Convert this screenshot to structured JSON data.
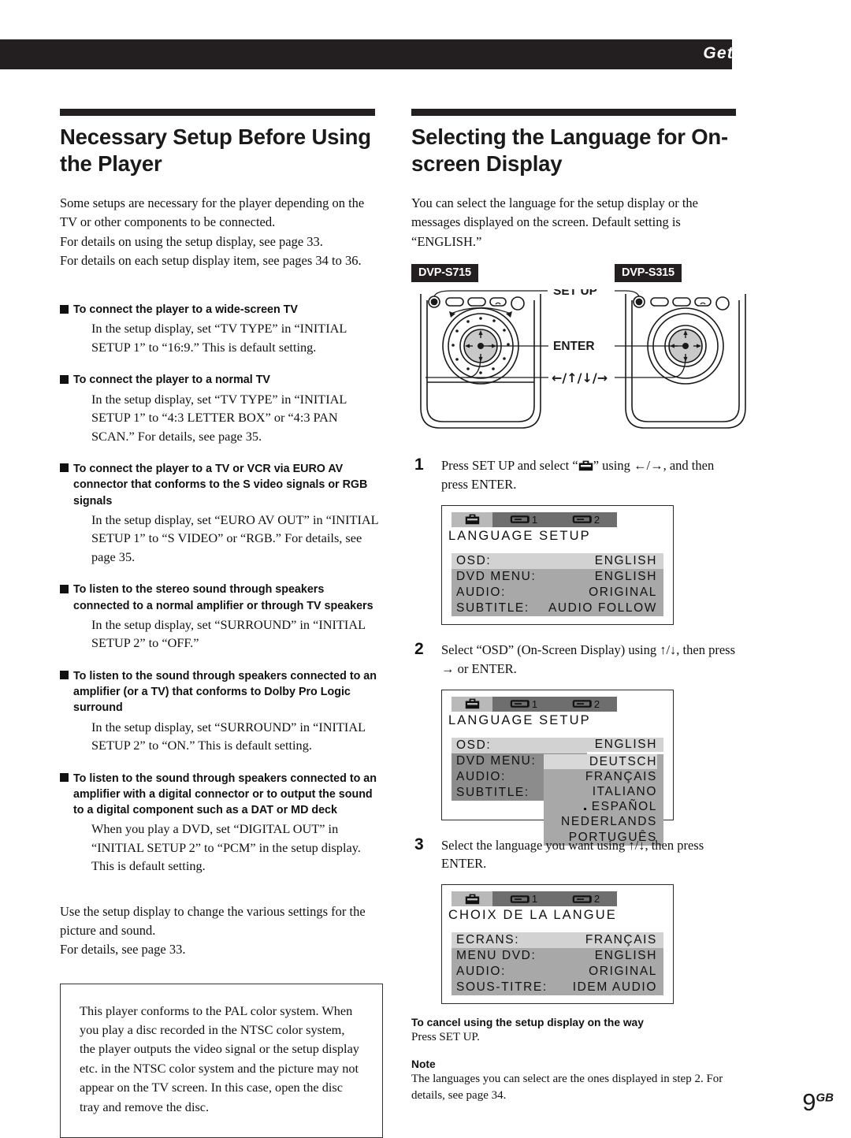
{
  "running_header": {
    "text": "Getting Started"
  },
  "left_column": {
    "heading": "Necessary Setup Before Using the Player",
    "intro": [
      "Some setups are necessary for the player depending on the TV or other components to be connected.",
      "For details on using the setup display, see page 33.",
      "For details on each setup display item, see pages 34 to 36."
    ],
    "bullets": [
      {
        "head": "To connect the player to a wide-screen TV",
        "body": "In the setup display, set “TV TYPE” in “INITIAL SETUP 1” to “16:9.”  This is default setting."
      },
      {
        "head": "To connect the player to a normal TV",
        "body": "In the setup display, set “TV TYPE” in “INITIAL SETUP 1” to “4:3 LETTER BOX” or “4:3 PAN SCAN.”  For details, see page 35."
      },
      {
        "head": "To connect the player to a TV or VCR via EURO AV connector that conforms to the S video signals or RGB signals",
        "body": "In the setup display, set “EURO AV OUT” in “INITIAL SETUP 1” to “S VIDEO” or “RGB.”  For details, see page 35."
      },
      {
        "head": "To listen to the stereo sound through speakers connected to a normal amplifier or through TV speakers",
        "body": "In the setup display, set “SURROUND” in “INITIAL SETUP 2” to “OFF.”"
      },
      {
        "head": "To listen to the sound through speakers connected to an amplifier (or a TV) that conforms to Dolby Pro Logic surround",
        "body": "In the setup display, set “SURROUND” in “INITIAL SETUP 2” to “ON.”  This is default setting."
      },
      {
        "head": "To listen to the sound through speakers connected to an amplifier with a digital connector or to output the sound to a digital component such as a DAT or MD deck",
        "body": "When you play a DVD, set “DIGITAL OUT” in “INITIAL SETUP 2” to “PCM” in the setup display.  This is default setting."
      }
    ],
    "closing": [
      "Use the setup display to change the various settings for the picture and sound.",
      "For details, see page 33."
    ],
    "framed_note": "This player conforms to the PAL color system. When you play a disc recorded in the NTSC color system, the player outputs the video signal or the setup display etc. in the NTSC color system and the picture may not appear on the TV screen.  In this case, open the disc tray and remove the disc."
  },
  "right_column": {
    "heading": "Selecting the Language for On-screen Display",
    "intro": "You can select the language for the setup display or the messages displayed on the screen.  Default setting is “ENGLISH.”",
    "badges": {
      "left": "DVP-S715",
      "right": "DVP-S315"
    },
    "remote_callouts": {
      "setup": "SET UP",
      "enter": "ENTER",
      "arrows": "←/↑/↓/→"
    },
    "steps": [
      {
        "num": "1",
        "text_before": "Press SET UP and select “",
        "icon": "toolbox-icon",
        "text_after": "” using ←/→, and then press ENTER."
      },
      {
        "num": "2",
        "text_before": "Select “OSD” (On-Screen Display) using ↑/↓, then press → or ENTER.",
        "icon": "",
        "text_after": ""
      },
      {
        "num": "3",
        "text_before": "Select the language you want using ↑/↓, then press ENTER.",
        "icon": "",
        "text_after": ""
      }
    ],
    "osd_screens": [
      {
        "tabs": {
          "selected": "toolbox-icon",
          "tab1": "1",
          "tab2": "2"
        },
        "title": "LANGUAGE SETUP",
        "rows": [
          {
            "label": "OSD:",
            "value": "ENGLISH",
            "highlight": true
          },
          {
            "label": "DVD MENU:",
            "value": "ENGLISH",
            "highlight": false
          },
          {
            "label": "AUDIO:",
            "value": "ORIGINAL",
            "highlight": false
          },
          {
            "label": "SUBTITLE:",
            "value": "AUDIO FOLLOW",
            "highlight": false
          }
        ]
      },
      {
        "tabs": {
          "selected": "toolbox-icon",
          "tab1": "1",
          "tab2": "2"
        },
        "title": "LANGUAGE SETUP",
        "rows": [
          {
            "label": "OSD:",
            "value": "ENGLISH",
            "highlight": true
          },
          {
            "label": "DVD MENU:",
            "value": "",
            "highlight": false
          },
          {
            "label": "AUDIO:",
            "value": "",
            "highlight": false
          },
          {
            "label": "SUBTITLE:",
            "value": "",
            "highlight": false
          }
        ],
        "popup_options": [
          {
            "label": "DEUTSCH",
            "selected": true
          },
          {
            "label": "FRANÇAIS",
            "selected": false
          },
          {
            "label": "ITALIANO",
            "selected": false
          },
          {
            "label": "ESPAÑOL",
            "selected": false
          },
          {
            "label": "NEDERLANDS",
            "selected": false
          },
          {
            "label": "PORTUGUÊS",
            "selected": false
          }
        ]
      },
      {
        "tabs": {
          "selected": "toolbox-icon",
          "tab1": "1",
          "tab2": "2"
        },
        "title": "CHOIX DE LA LANGUE",
        "rows": [
          {
            "label": "ECRANS:",
            "value": "FRANÇAIS",
            "highlight": true
          },
          {
            "label": "MENU DVD:",
            "value": "ENGLISH",
            "highlight": false
          },
          {
            "label": "AUDIO:",
            "value": "ORIGINAL",
            "highlight": false
          },
          {
            "label": "SOUS-TITRE:",
            "value": "IDEM AUDIO",
            "highlight": false
          }
        ]
      }
    ],
    "cancel_head": "To cancel using the setup display on the way",
    "cancel_body": "Press SET UP.",
    "note_head": "Note",
    "note_body": "The languages you can select are the ones displayed in step 2. For details, see page 34."
  },
  "page_number": {
    "num": "9",
    "sup": "GB"
  }
}
